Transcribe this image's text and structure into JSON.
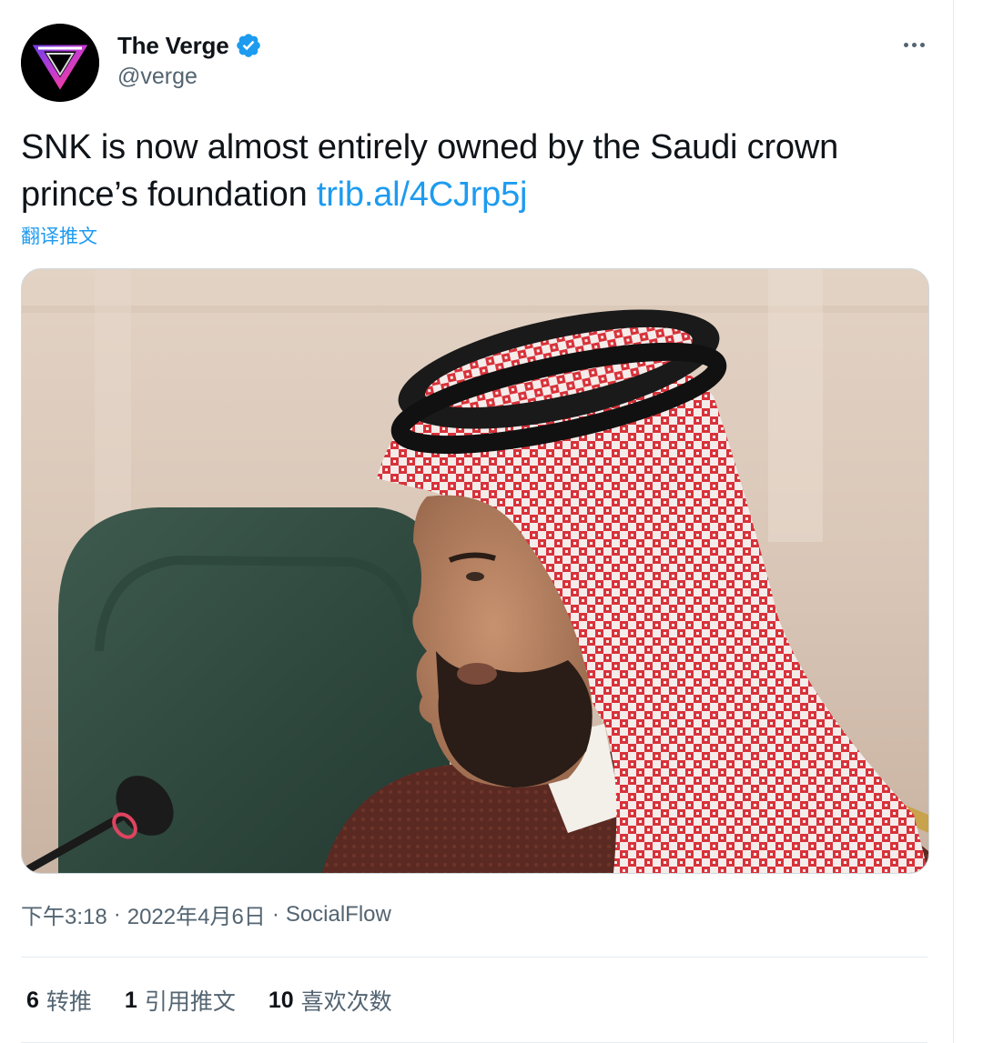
{
  "author": {
    "display_name": "The Verge",
    "handle": "@verge",
    "verified": true,
    "avatar_icon": "verge-logo-icon"
  },
  "tweet": {
    "text": "SNK is now almost entirely owned by the Saudi crown prince’s foundation",
    "link_text": "trib.al/4CJrp5j",
    "translate_label": "翻译推文"
  },
  "media": {
    "kind": "photo"
  },
  "meta": {
    "time": "下午3:18",
    "separator": "·",
    "date": "2022年4月6日",
    "source": "SocialFlow"
  },
  "stats": [
    {
      "count": "6",
      "label": "转推"
    },
    {
      "count": "1",
      "label": "引用推文"
    },
    {
      "count": "10",
      "label": "喜欢次数"
    }
  ],
  "colors": {
    "link": "#1d9bf0",
    "secondary_text": "#536471",
    "primary_text": "#0f1419",
    "border": "#cfd9de"
  }
}
